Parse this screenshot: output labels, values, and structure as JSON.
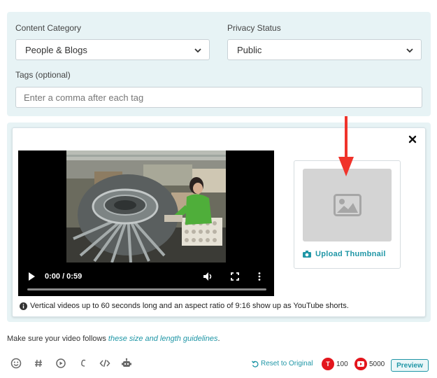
{
  "settings": {
    "category_label": "Content Category",
    "category_value": "People & Blogs",
    "privacy_label": "Privacy Status",
    "privacy_value": "Public",
    "tags_label": "Tags (optional)",
    "tags_placeholder": "Enter a comma after each tag"
  },
  "media": {
    "video_time": "0:00 / 0:59",
    "upload_label": "Upload Thumbnail",
    "info_text": "Vertical videos up to 60 seconds long and an aspect ratio of 9:16 show up as YouTube shorts."
  },
  "footer": {
    "guideline_prefix": "Make sure your video follows ",
    "guideline_link": "these size and length guidelines",
    "guideline_suffix": ".",
    "reset_label": "Reset to Original",
    "twitter_badge": "T",
    "twitter_count": "100",
    "youtube_count": "5000",
    "preview_label": "Preview"
  },
  "colors": {
    "accent": "#1f96a6",
    "panel_bg": "#e7f3f5",
    "badge_red": "#e3151c",
    "annotation_arrow": "#f0332b"
  },
  "icons": [
    "chevron-down-icon",
    "close-icon",
    "play-icon",
    "volume-icon",
    "fullscreen-icon",
    "more-vertical-icon",
    "image-icon",
    "camera-icon",
    "info-icon",
    "emoji-icon",
    "hashtag-icon",
    "media-icon",
    "script-icon",
    "code-icon",
    "bot-icon",
    "reset-icon",
    "youtube-icon",
    "arrow-down-icon"
  ]
}
